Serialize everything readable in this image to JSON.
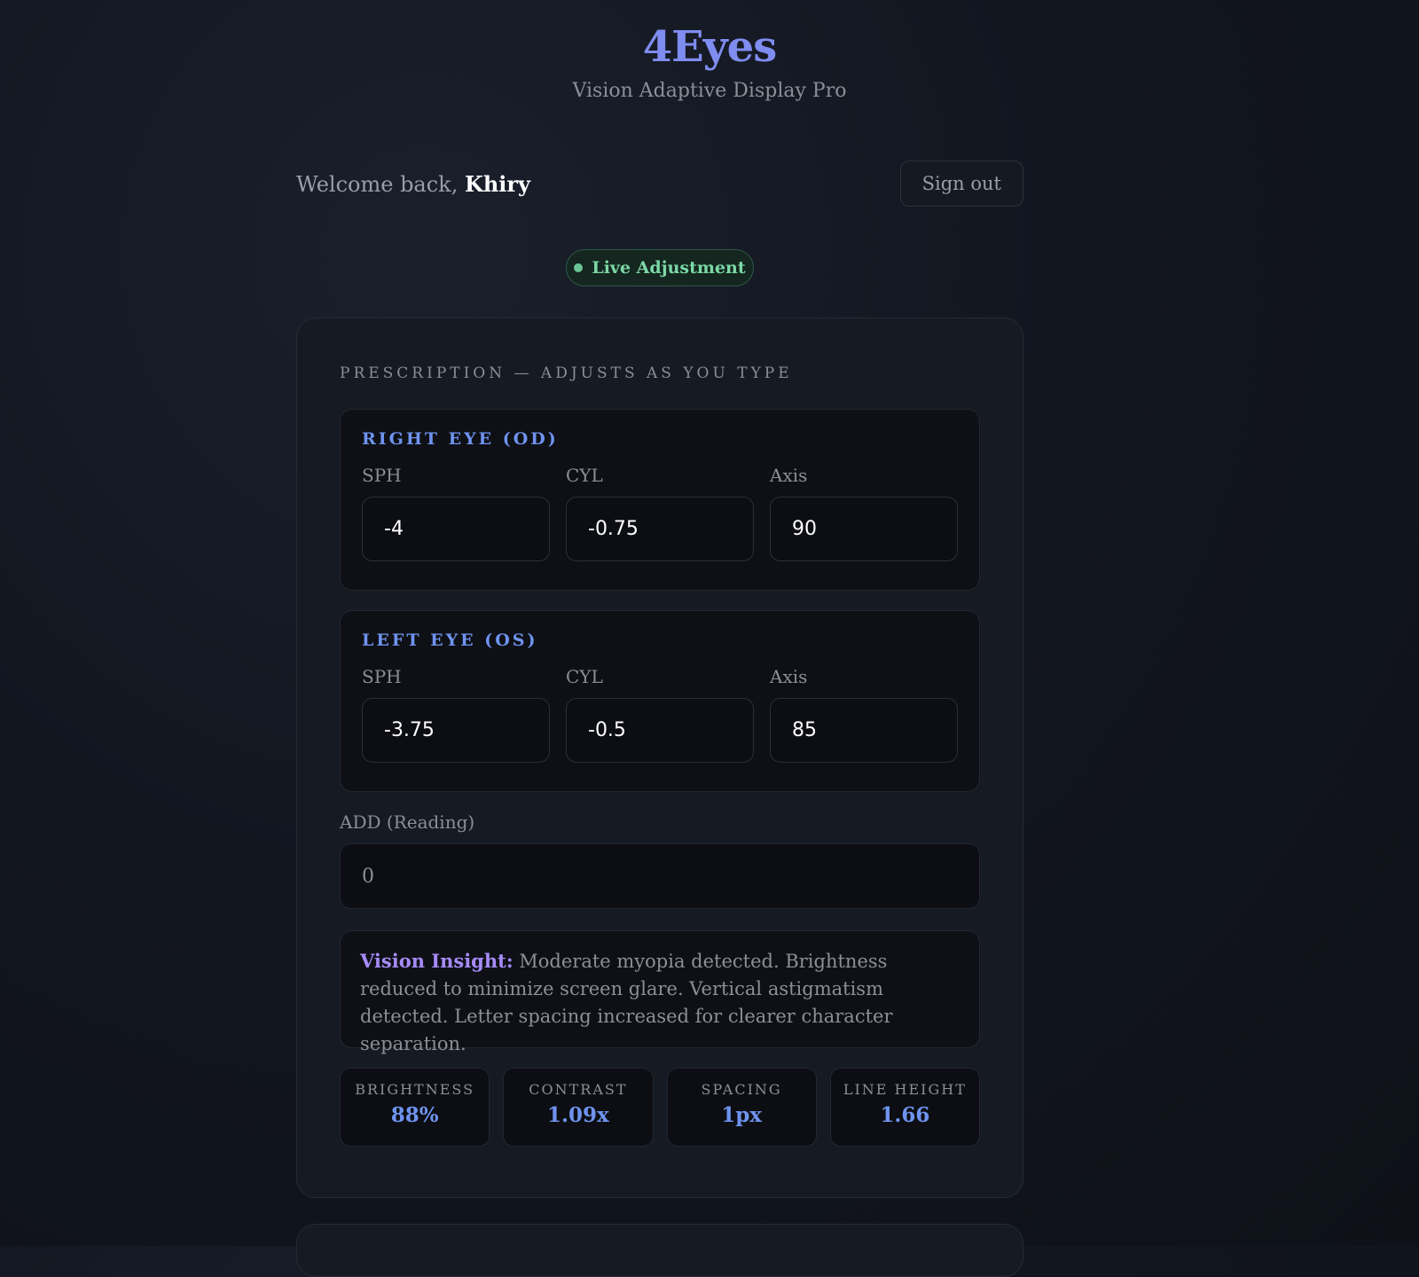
{
  "app": {
    "title": "4Eyes",
    "subtitle": "Vision Adaptive Display Pro"
  },
  "user": {
    "greeting": "Welcome back, ",
    "name": "Khiry",
    "signout_label": "Sign out"
  },
  "status": {
    "live_label": "Live Adjustment",
    "color": "#7bd8a6"
  },
  "prescription": {
    "section_label": "PRESCRIPTION — ADJUSTS AS YOU TYPE",
    "right_eye": {
      "title": "RIGHT EYE (OD)",
      "sph_label": "SPH",
      "cyl_label": "CYL",
      "axis_label": "Axis",
      "sph": "-4",
      "cyl": "-0.75",
      "axis": "90"
    },
    "left_eye": {
      "title": "LEFT EYE (OS)",
      "sph_label": "SPH",
      "cyl_label": "CYL",
      "axis_label": "Axis",
      "sph": "-3.75",
      "cyl": "-0.5",
      "axis": "85"
    },
    "add_label": "ADD (Reading)",
    "add_value": "0"
  },
  "insight": {
    "label": "Vision Insight:",
    "text": " Moderate myopia detected. Brightness reduced to minimize screen glare. Vertical astigmatism detected. Letter spacing increased for clearer character separation."
  },
  "stats": [
    {
      "label": "BRIGHTNESS",
      "value": "88%"
    },
    {
      "label": "CONTRAST",
      "value": "1.09x"
    },
    {
      "label": "SPACING",
      "value": "1px"
    },
    {
      "label": "LINE HEIGHT",
      "value": "1.66"
    }
  ],
  "colors": {
    "accent": "#7f8cf0",
    "eye_title": "#6f93ef",
    "insight_label": "#a78bfa"
  }
}
